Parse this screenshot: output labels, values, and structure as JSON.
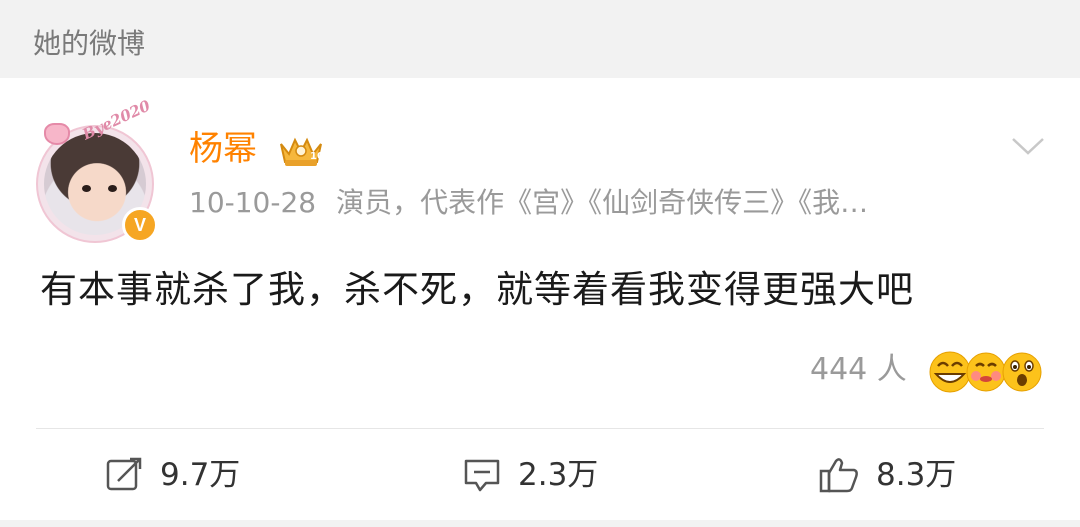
{
  "section": {
    "title": "她的微博"
  },
  "post": {
    "author": {
      "name": "杨幂",
      "verified_badge": "V",
      "avatar_text": "Bye2020"
    },
    "meta": {
      "date": "10-10-28",
      "description": "演员，代表作《宫》《仙剑奇侠传三》《我…"
    },
    "text": "有本事就杀了我，杀不死，就等着看我变得更强大吧",
    "reactions": {
      "count_text": "444 人"
    },
    "actions": {
      "repost": "9.7万",
      "comment": "2.3万",
      "like": "8.3万"
    }
  },
  "colors": {
    "accent": "#ff8200",
    "muted": "#9a9a9a",
    "badge": "#f6a623"
  },
  "icons": [
    "chevron-down-icon",
    "vip-crown-icon",
    "repost-icon",
    "comment-icon",
    "like-icon",
    "laugh-emoji-icon",
    "blush-emoji-icon",
    "shock-emoji-icon"
  ]
}
